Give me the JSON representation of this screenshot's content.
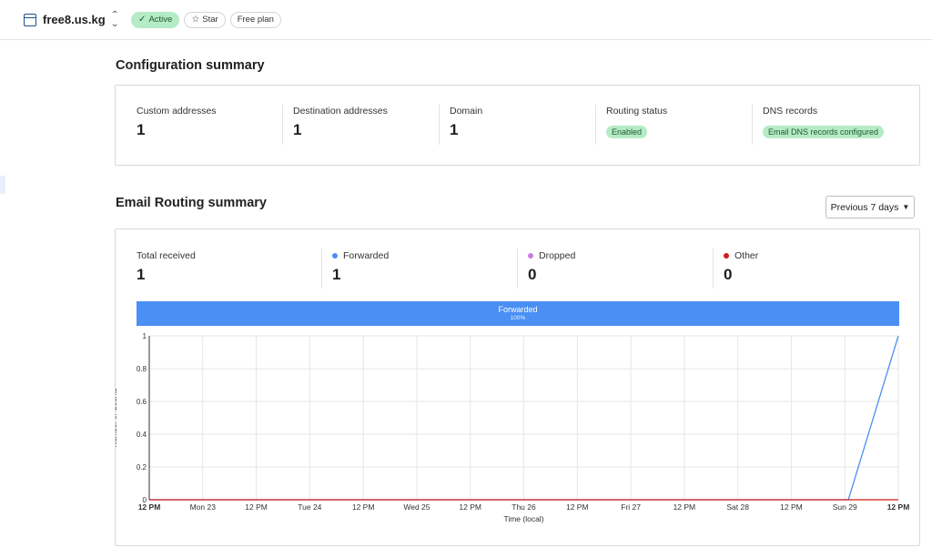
{
  "header": {
    "site_name": "free8.us.kg",
    "status_label": "Active",
    "star_label": "Star",
    "plan_label": "Free plan"
  },
  "config_summary": {
    "title": "Configuration summary",
    "stats": [
      {
        "label": "Custom addresses",
        "value": "1"
      },
      {
        "label": "Destination addresses",
        "value": "1"
      },
      {
        "label": "Domain",
        "value": "1"
      },
      {
        "label": "Routing status",
        "badge": "Enabled"
      },
      {
        "label": "DNS records",
        "badge": "Email DNS records configured"
      }
    ]
  },
  "routing_summary": {
    "title": "Email Routing summary",
    "range_select": "Previous 7 days",
    "stats": [
      {
        "label": "Total received",
        "value": "1"
      },
      {
        "label": "Forwarded",
        "value": "1",
        "color": "#4a8ff3"
      },
      {
        "label": "Dropped",
        "value": "0",
        "color": "#c77fe0"
      },
      {
        "label": "Other",
        "value": "0",
        "color": "#d11a1a"
      }
    ],
    "share_bar": {
      "label": "Forwarded",
      "percent_label": "100%",
      "fraction": 1.0
    }
  },
  "chart_data": {
    "type": "line",
    "ylabel": "Number of Counts",
    "xlabel": "Time (local)",
    "ylim": [
      0,
      1
    ],
    "y_ticks": [
      "0",
      "0.2",
      "0.4",
      "0.6",
      "0.8",
      "1"
    ],
    "x_ticks": [
      "12 PM",
      "Mon 23",
      "12 PM",
      "Tue 24",
      "12 PM",
      "Wed 25",
      "12 PM",
      "Thu 26",
      "12 PM",
      "Fri 27",
      "12 PM",
      "Sat 28",
      "12 PM",
      "Sun 29",
      "12 PM"
    ],
    "grid": true,
    "series": [
      {
        "name": "Forwarded",
        "color": "#4a8ff3",
        "values": [
          0,
          0,
          0,
          0,
          0,
          0,
          0,
          0,
          0,
          0,
          0,
          0,
          0,
          0,
          0,
          1
        ]
      },
      {
        "name": "Other",
        "color": "#d11a1a",
        "values": [
          0,
          0,
          0,
          0,
          0,
          0,
          0,
          0,
          0,
          0,
          0,
          0,
          0,
          0,
          0,
          0
        ]
      }
    ]
  }
}
